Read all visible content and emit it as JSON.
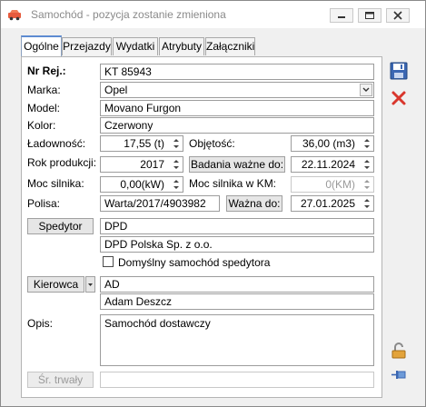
{
  "window": {
    "title": "Samochód - pozycja zostanie zmieniona"
  },
  "tabs": [
    {
      "label": "Ogólne",
      "active": true
    },
    {
      "label": "Przejazdy"
    },
    {
      "label": "Wydatki"
    },
    {
      "label": "Atrybuty"
    },
    {
      "label": "Załączniki"
    }
  ],
  "form": {
    "nr_rej": {
      "label": "Nr Rej.:",
      "value": "KT 85943"
    },
    "marka": {
      "label": "Marka:",
      "value": "Opel"
    },
    "model": {
      "label": "Model:",
      "value": "Movano Furgon"
    },
    "kolor": {
      "label": "Kolor:",
      "value": "Czerwony"
    },
    "ladownosc": {
      "label": "Ładowność:",
      "value": "17,55 (t)"
    },
    "objetosc": {
      "label": "Objętość:",
      "value": "36,00 (m3)"
    },
    "rok_produkcji": {
      "label": "Rok produkcji:",
      "value": "2017"
    },
    "badania": {
      "button": "Badania ważne do:",
      "value": "22.11.2024"
    },
    "moc_silnika": {
      "label": "Moc silnika:",
      "value": "0,00(kW)"
    },
    "moc_km": {
      "label": "Moc silnika w KM:",
      "value": "0(KM)"
    },
    "polisa": {
      "label": "Polisa:",
      "value": "Warta/2017/4903982"
    },
    "wazna": {
      "button": "Ważna do:",
      "value": "27.01.2025"
    },
    "spedytor": {
      "button": "Spedytor",
      "code": "DPD",
      "name": "DPD  Polska Sp. z o.o."
    },
    "domyslny": {
      "label": "Domyślny samochód spedytora",
      "checked": false
    },
    "kierowca": {
      "button": "Kierowca",
      "code": "AD",
      "name": "Adam Deszcz"
    },
    "opis": {
      "label": "Opis:",
      "value": "Samochód dostawczy"
    },
    "sr_trwaly": {
      "button": "Śr. trwały",
      "value": ""
    }
  },
  "icons": {
    "app": "car-icon",
    "save": "save-icon",
    "cancel": "close-icon",
    "lock": "lock-icon",
    "pin": "pin-icon"
  },
  "colors": {
    "accent": "#5d8bd1",
    "cancel_red": "#d9362c",
    "save_blue": "#3b67b2"
  }
}
